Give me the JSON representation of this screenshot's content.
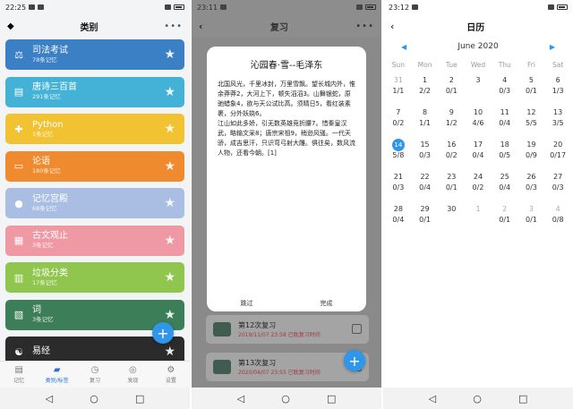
{
  "panel1": {
    "status_time": "22:25",
    "title": "类别",
    "menu": "•••",
    "fab_label": "+",
    "categories": [
      {
        "name": "司法考试",
        "count": "78条记忆",
        "color": "#3b7fc4",
        "icon": "scale-icon",
        "glyph": "⚖"
      },
      {
        "name": "唐诗三百首",
        "count": "291条记忆",
        "color": "#44b2d6",
        "icon": "book-icon",
        "glyph": "▤"
      },
      {
        "name": "Python",
        "count": "1条记忆",
        "color": "#f1c232",
        "icon": "python-icon",
        "glyph": "✚"
      },
      {
        "name": "论语",
        "count": "180条记忆",
        "color": "#ef8a2e",
        "icon": "scroll-icon",
        "glyph": "▭"
      },
      {
        "name": "记忆宫殿",
        "count": "68条记忆",
        "color": "#aabde3",
        "icon": "pin-icon",
        "glyph": "●"
      },
      {
        "name": "古文观止",
        "count": "3条记忆",
        "color": "#ef99a5",
        "icon": "image-icon",
        "glyph": "▦"
      },
      {
        "name": "垃圾分类",
        "count": "17条记忆",
        "color": "#91c64e",
        "icon": "trash-icon",
        "glyph": "▥"
      },
      {
        "name": "词",
        "count": "3条记忆",
        "color": "#3c7e57",
        "icon": "scroll-icon",
        "glyph": "▧"
      },
      {
        "name": "易经",
        "count": "",
        "color": "#2b2b2b",
        "icon": "yinyang-icon",
        "glyph": "☯"
      }
    ],
    "nav": [
      {
        "label": "记忆",
        "glyph": "▤"
      },
      {
        "label": "类别/标签",
        "glyph": "▰"
      },
      {
        "label": "复习",
        "glyph": "◷"
      },
      {
        "label": "发现",
        "glyph": "◎"
      },
      {
        "label": "设置",
        "glyph": "⚙"
      }
    ]
  },
  "panel2": {
    "status_time": "23:11",
    "title": "复习",
    "dialog_title": "沁园春·雪--毛泽东",
    "dialog_body": "北国风光，千里冰封，万里雪飘。望长城内外，惟余莽莽2，大河上下，顿失滔滔3。山舞银蛇，原驰蜡象4，欲与天公试比高。须晴日5，看红装素裹，分外妖娆6。\n江山如此多娇，引无数英雄竞折腰7。惜秦皇汉武，略输文采8；唐宗宋祖9，稍逊风骚。一代天骄，成吉思汗，只识弯弓射大雕。俱往矣，数风流人物，还看今朝。[1]",
    "skip": "跳过",
    "done": "完成",
    "reviews": [
      {
        "title": "第12次复习",
        "meta": "2019/11/07 23:58  已耽复习时间"
      },
      {
        "title": "第13次复习",
        "meta": "2020/04/07 23:55  已耽复习时间"
      }
    ]
  },
  "panel3": {
    "status_time": "23:12",
    "title": "日历",
    "month": "June 2020",
    "prev": "◀",
    "next": "▶",
    "weekdays": [
      "Sun",
      "Mon",
      "Tue",
      "Wed",
      "Thu",
      "Fri",
      "Sat"
    ],
    "days": [
      {
        "d": "31",
        "r": "1/1",
        "muted": true
      },
      {
        "d": "1",
        "r": "2/2"
      },
      {
        "d": "2",
        "r": "0/1"
      },
      {
        "d": "3",
        "r": ""
      },
      {
        "d": "4",
        "r": "0/3"
      },
      {
        "d": "5",
        "r": "0/1"
      },
      {
        "d": "6",
        "r": "1/3"
      },
      {
        "d": "7",
        "r": "0/2"
      },
      {
        "d": "8",
        "r": "1/1"
      },
      {
        "d": "9",
        "r": "1/2"
      },
      {
        "d": "10",
        "r": "4/6"
      },
      {
        "d": "11",
        "r": "0/4"
      },
      {
        "d": "12",
        "r": "5/5"
      },
      {
        "d": "13",
        "r": "3/5"
      },
      {
        "d": "14",
        "r": "5/8",
        "today": true
      },
      {
        "d": "15",
        "r": "0/3"
      },
      {
        "d": "16",
        "r": "0/2"
      },
      {
        "d": "17",
        "r": "0/4"
      },
      {
        "d": "18",
        "r": "0/5"
      },
      {
        "d": "19",
        "r": "0/9"
      },
      {
        "d": "20",
        "r": "0/17"
      },
      {
        "d": "21",
        "r": "0/3"
      },
      {
        "d": "22",
        "r": "0/4"
      },
      {
        "d": "23",
        "r": "0/1"
      },
      {
        "d": "24",
        "r": "0/2"
      },
      {
        "d": "25",
        "r": "0/4"
      },
      {
        "d": "26",
        "r": "0/3"
      },
      {
        "d": "27",
        "r": "0/3"
      },
      {
        "d": "28",
        "r": "0/4"
      },
      {
        "d": "29",
        "r": "0/1"
      },
      {
        "d": "30",
        "r": ""
      },
      {
        "d": "1",
        "r": "",
        "muted": true
      },
      {
        "d": "2",
        "r": "0/1",
        "muted": true
      },
      {
        "d": "3",
        "r": "0/1",
        "muted": true
      },
      {
        "d": "4",
        "r": "0/8",
        "muted": true
      }
    ]
  },
  "system_nav": {
    "back": "◁",
    "home": "○",
    "recent": "□"
  }
}
